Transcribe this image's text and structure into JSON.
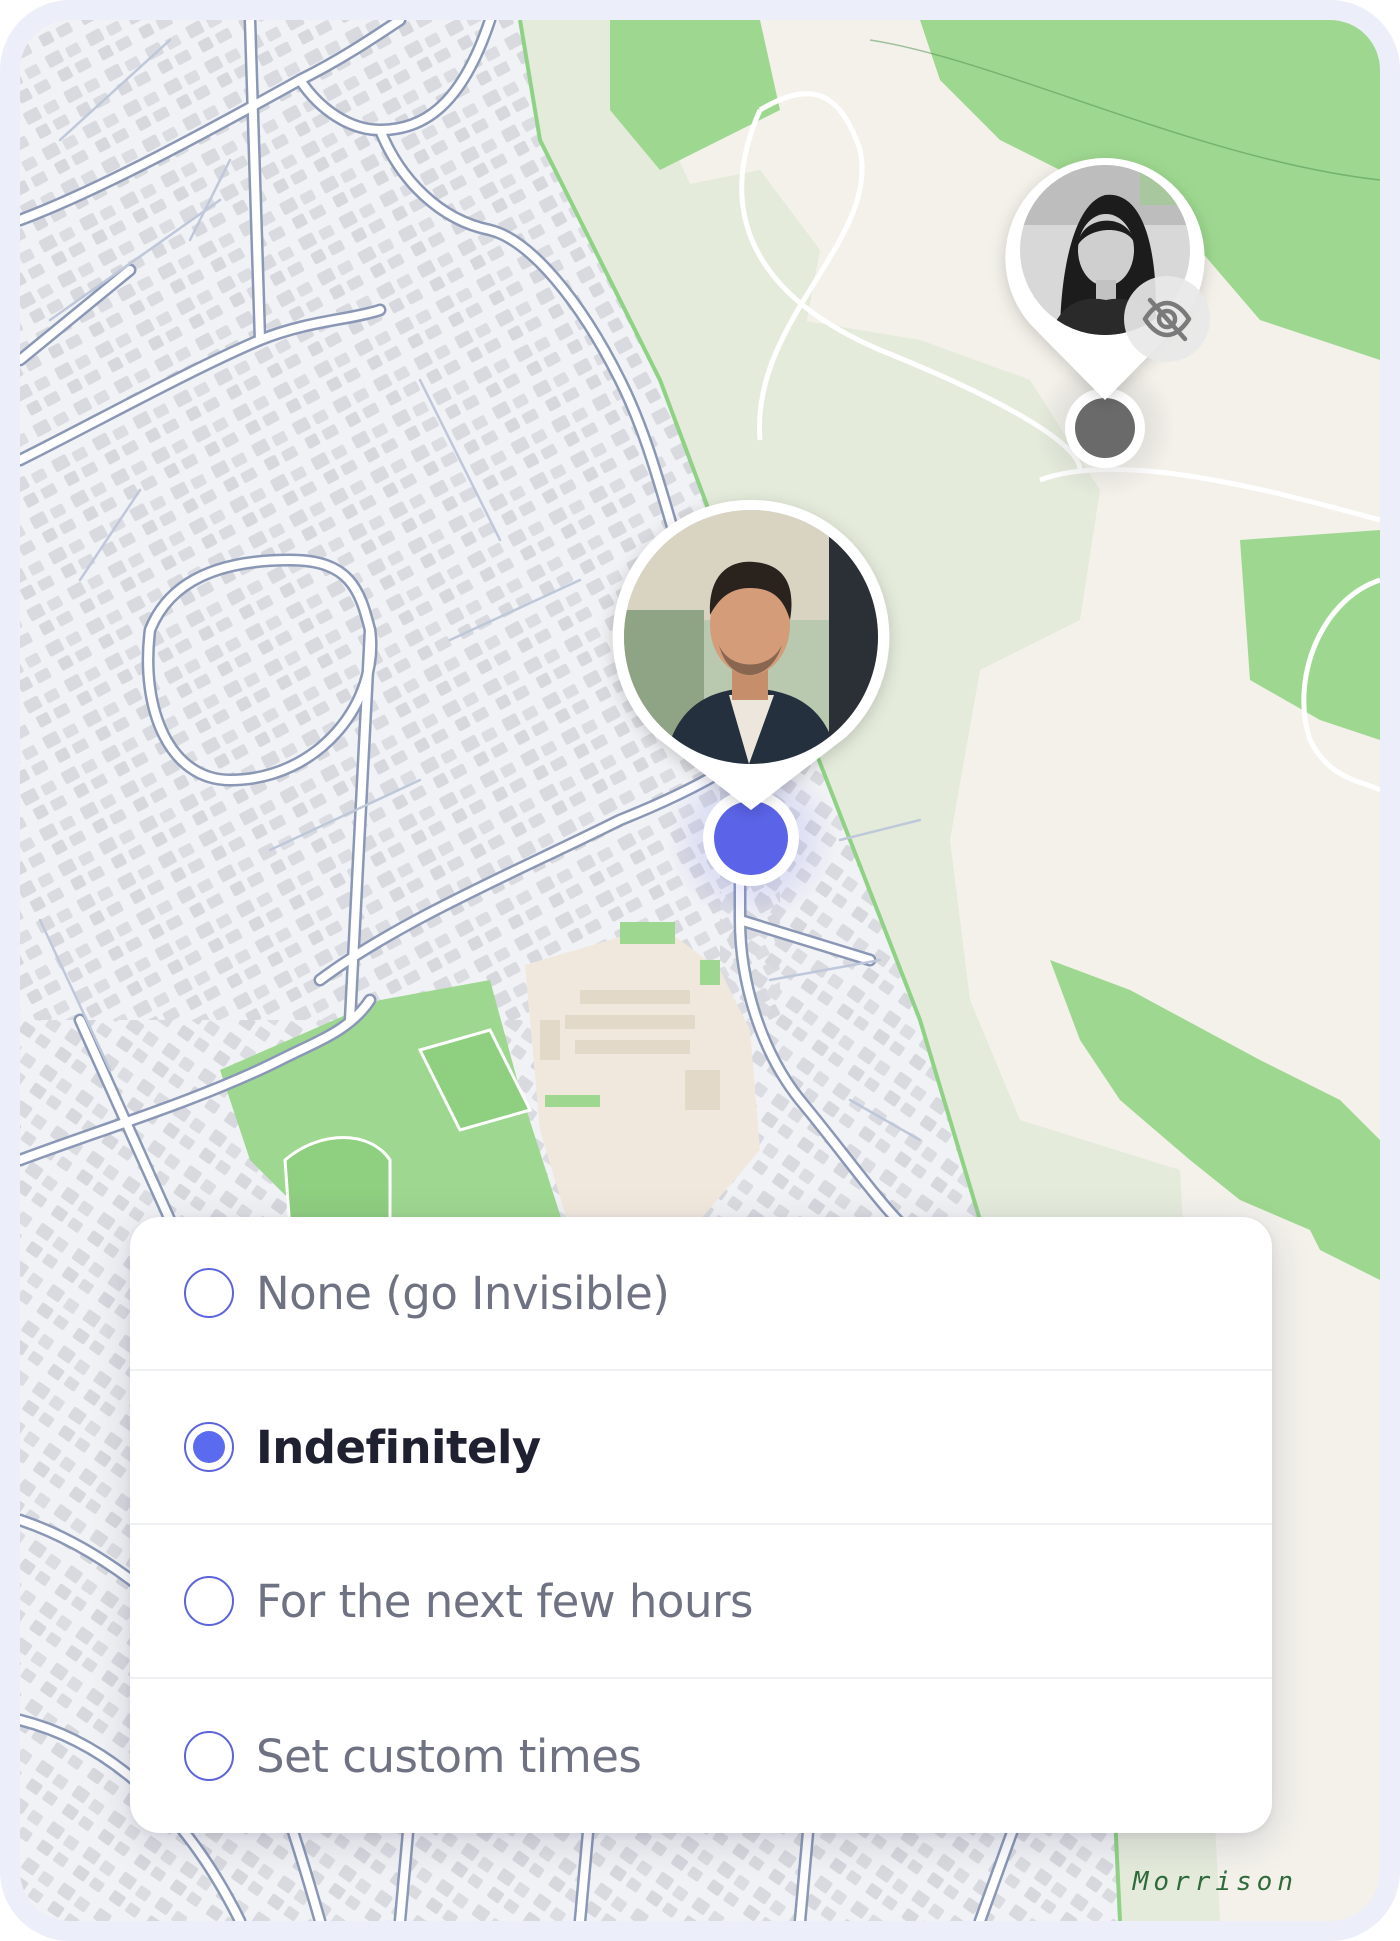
{
  "map": {
    "street_label": "Morrison",
    "colors": {
      "base": "#f1f2f5",
      "park_light": "#e4ebdb",
      "park_dark": "#9ed890",
      "trail_sand": "#f3f1ea",
      "road_outline": "#8a98b6",
      "building": "#d9dadf",
      "school_lot": "#f1e8dd"
    }
  },
  "pins": [
    {
      "name": "contact-woman",
      "visible": false,
      "status_icon": "eye-off-icon",
      "marker_color": "#6a6a6a"
    },
    {
      "name": "current-user-man",
      "visible": true,
      "marker_color": "#5b63e8"
    }
  ],
  "sharing_options": {
    "selected_index": 1,
    "accent_color": "#5b6bf0",
    "items": [
      {
        "label": "None (go Invisible)"
      },
      {
        "label": "Indefinitely"
      },
      {
        "label": "For the next few hours"
      },
      {
        "label": "Set custom times"
      }
    ]
  }
}
